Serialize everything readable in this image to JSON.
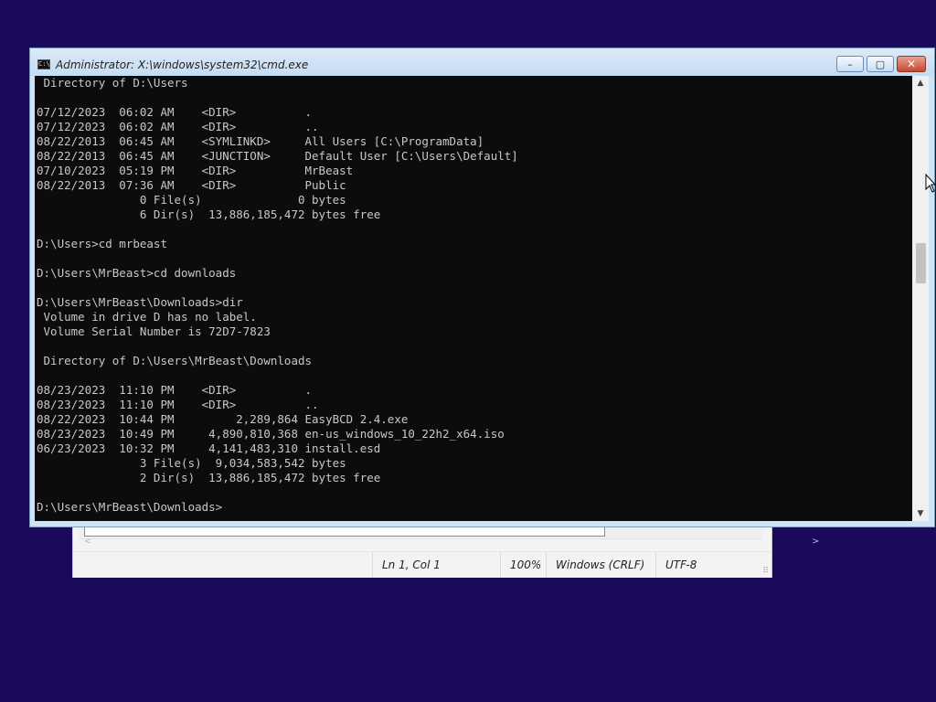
{
  "cmd_window": {
    "title": "Administrator: X:\\windows\\system32\\cmd.exe",
    "icon_label": "C:\\",
    "minimize": "–",
    "maximize": "▢",
    "close": "✕",
    "console_lines": [
      " Directory of D:\\Users",
      "",
      "07/12/2023  06:02 AM    <DIR>          .",
      "07/12/2023  06:02 AM    <DIR>          ..",
      "08/22/2013  06:45 AM    <SYMLINKD>     All Users [C:\\ProgramData]",
      "08/22/2013  06:45 AM    <JUNCTION>     Default User [C:\\Users\\Default]",
      "07/10/2023  05:19 PM    <DIR>          MrBeast",
      "08/22/2013  07:36 AM    <DIR>          Public",
      "               0 File(s)              0 bytes",
      "               6 Dir(s)  13,886,185,472 bytes free",
      "",
      "D:\\Users>cd mrbeast",
      "",
      "D:\\Users\\MrBeast>cd downloads",
      "",
      "D:\\Users\\MrBeast\\Downloads>dir",
      " Volume in drive D has no label.",
      " Volume Serial Number is 72D7-7823",
      "",
      " Directory of D:\\Users\\MrBeast\\Downloads",
      "",
      "08/23/2023  11:10 PM    <DIR>          .",
      "08/23/2023  11:10 PM    <DIR>          ..",
      "08/22/2023  10:44 PM         2,289,864 EasyBCD 2.4.exe",
      "08/23/2023  10:49 PM     4,890,810,368 en-us_windows_10_22h2_x64.iso",
      "06/23/2023  10:32 PM     4,141,483,310 install.esd",
      "               3 File(s)  9,034,583,542 bytes",
      "               2 Dir(s)  13,886,185,472 bytes free",
      "",
      "D:\\Users\\MrBeast\\Downloads>"
    ],
    "scrollbar": {
      "up": "▲",
      "down": "▼"
    }
  },
  "notepad": {
    "status": {
      "position": "Ln 1, Col 1",
      "zoom": "100%",
      "line_ending": "Windows (CRLF)",
      "encoding": "UTF-8"
    },
    "scroll_left": "<",
    "scroll_right": ">",
    "grip": "⠿"
  },
  "colors": {
    "desktop": "#1b0a5c",
    "console_bg": "#0c0c0c",
    "console_text": "#c8c8c8"
  }
}
